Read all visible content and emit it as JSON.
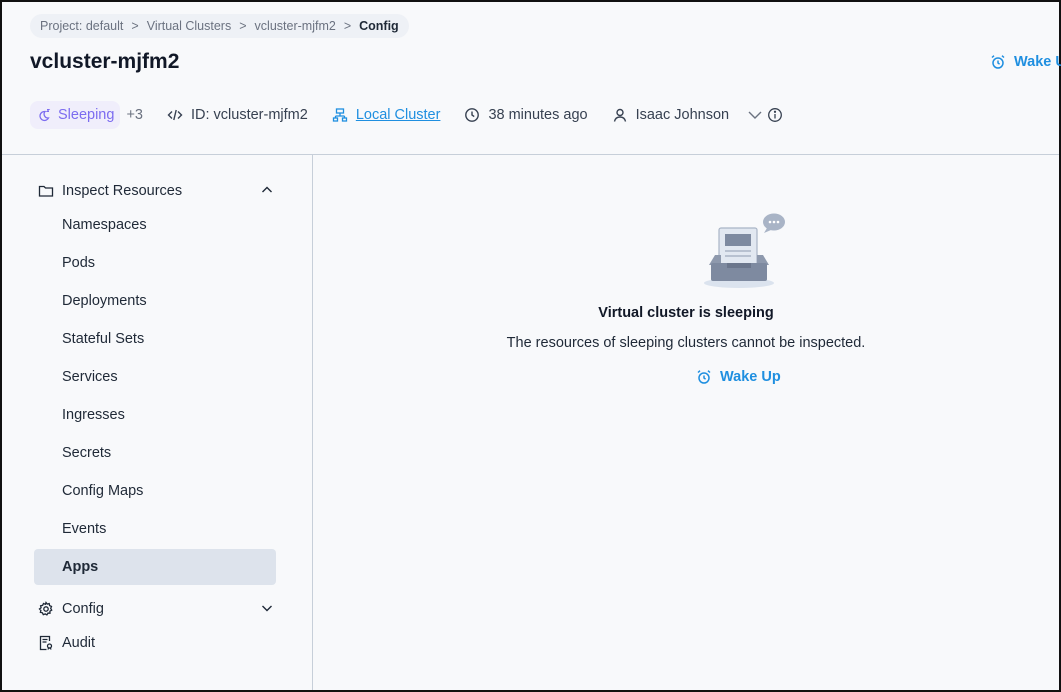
{
  "breadcrumb": {
    "items": [
      "Project: default",
      "Virtual Clusters",
      "vcluster-mjfm2"
    ],
    "current": "Config",
    "separator": ">"
  },
  "header": {
    "title": "vcluster-mjfm2",
    "wake_label": "Wake Up"
  },
  "meta": {
    "status": "Sleeping",
    "extra_count": "+3",
    "id_text": "ID: vcluster-mjfm2",
    "cluster": "Local Cluster",
    "age": "38 minutes ago",
    "owner": "Isaac Johnson"
  },
  "sidebar": {
    "inspect_label": "Inspect Resources",
    "items": [
      {
        "label": "Namespaces"
      },
      {
        "label": "Pods"
      },
      {
        "label": "Deployments"
      },
      {
        "label": "Stateful Sets"
      },
      {
        "label": "Services"
      },
      {
        "label": "Ingresses"
      },
      {
        "label": "Secrets"
      },
      {
        "label": "Config Maps"
      },
      {
        "label": "Events"
      },
      {
        "label": "Apps"
      }
    ],
    "active_item": "Apps",
    "config_label": "Config",
    "audit_label": "Audit"
  },
  "empty_state": {
    "title": "Virtual cluster is sleeping",
    "description": "The resources of sleeping clusters cannot be inspected.",
    "button_label": "Wake Up"
  },
  "colors": {
    "accent": "#1f8fe0",
    "sleeping": "#7c6cf0",
    "active_bg": "#dde3ec"
  },
  "icons": [
    "sleep-icon",
    "code-icon",
    "cluster-icon",
    "clock-icon",
    "user-icon",
    "chevron-down-icon",
    "info-icon",
    "folder-icon",
    "chevron-up-icon",
    "gear-icon",
    "audit-icon",
    "alarm-clock-icon"
  ]
}
